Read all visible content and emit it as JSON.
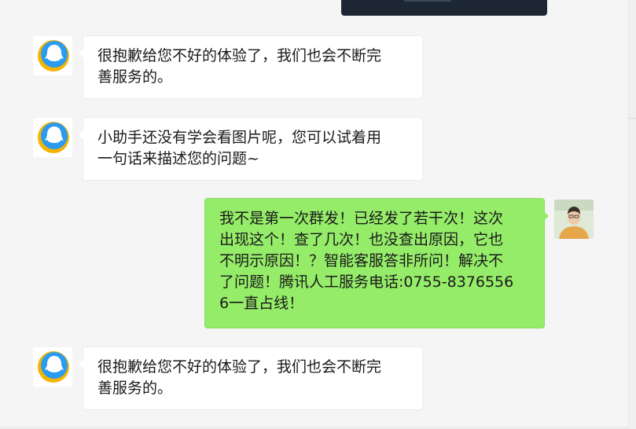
{
  "colors": {
    "background": "#f5f5f5",
    "incoming_bubble": "#ffffff",
    "outgoing_bubble": "#95ec69",
    "qq_blue": "#2a9bf0",
    "qq_yellow": "#f5b400"
  },
  "messages": [
    {
      "sender": "assistant",
      "avatar_icon": "qq-assistant-icon",
      "lines": [
        "很抱歉给您不好的体验了，我们也会不断完",
        "善服务的。"
      ]
    },
    {
      "sender": "assistant",
      "avatar_icon": "qq-assistant-icon",
      "lines": [
        "小助手还没有学会看图片呢，您可以试着用",
        "一句话来描述您的问题~"
      ]
    },
    {
      "sender": "user",
      "avatar_icon": "user-photo-avatar",
      "lines": [
        "我不是第一次群发！已经发了若干次！这次",
        "出现这个！查了几次！也没查出原因，它也",
        "不明示原因！？智能客服答非所问！解决不",
        "了问题！腾讯人工服务电话:0755-8376556",
        "6一直占线！"
      ]
    },
    {
      "sender": "assistant",
      "avatar_icon": "qq-assistant-icon",
      "lines": [
        "很抱歉给您不好的体验了，我们也会不断完",
        "善服务的。"
      ]
    }
  ]
}
